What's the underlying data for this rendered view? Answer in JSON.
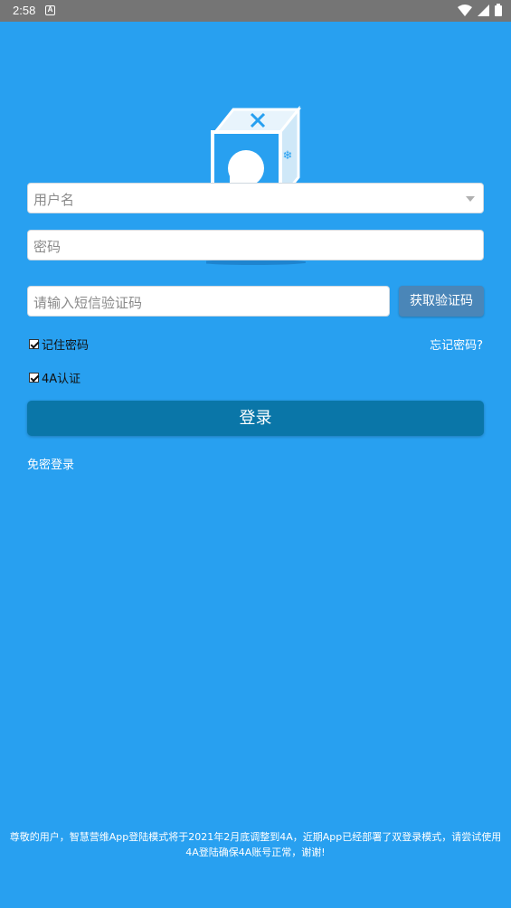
{
  "status_bar": {
    "time": "2:58",
    "notification_icon": "A",
    "icons": [
      "wifi-icon",
      "signal-icon",
      "battery-icon"
    ]
  },
  "login_form": {
    "username_placeholder": "用户名",
    "password_placeholder": "密码",
    "sms_placeholder": "请输入短信验证码",
    "get_code_label": "获取验证码",
    "remember_password_label": "记住密码",
    "remember_password_checked": true,
    "auth_4a_label": "4A认证",
    "auth_4a_checked": true,
    "forgot_password_label": "忘记密码?",
    "login_label": "登录",
    "password_free_login_label": "免密登录"
  },
  "notice_text": "尊敬的用户，智慧营维App登陆模式将于2021年2月底调整到4A，近期App已经部署了双登录模式，请尝试使用4A登陆确保4A账号正常，谢谢!",
  "colors": {
    "background": "#28a0f0",
    "status_bar": "#757575",
    "login_button": "#0a76a8",
    "sms_button": "#4a86b8"
  }
}
